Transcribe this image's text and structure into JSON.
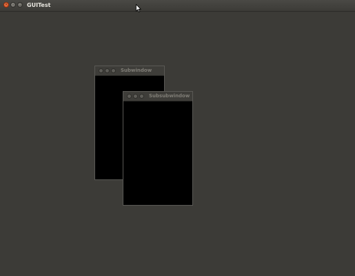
{
  "window": {
    "title": "GUITest",
    "controls": {
      "close_icon": "close-icon",
      "minimize_icon": "minimize-icon",
      "maximize_icon": "maximize-icon"
    }
  },
  "subwindow": {
    "title": "Subwindow",
    "controls": [
      "close-icon",
      "minimize-icon",
      "maximize-icon"
    ]
  },
  "subsubwindow": {
    "title": "Subsubwindow",
    "controls": [
      "close-icon",
      "minimize-icon",
      "maximize-icon"
    ]
  },
  "colors": {
    "desktop_background": "#3c3b37",
    "close_button": "#e0521f",
    "subwindow_content": "#000000",
    "subwindow_title_text": "#7f7d76"
  }
}
